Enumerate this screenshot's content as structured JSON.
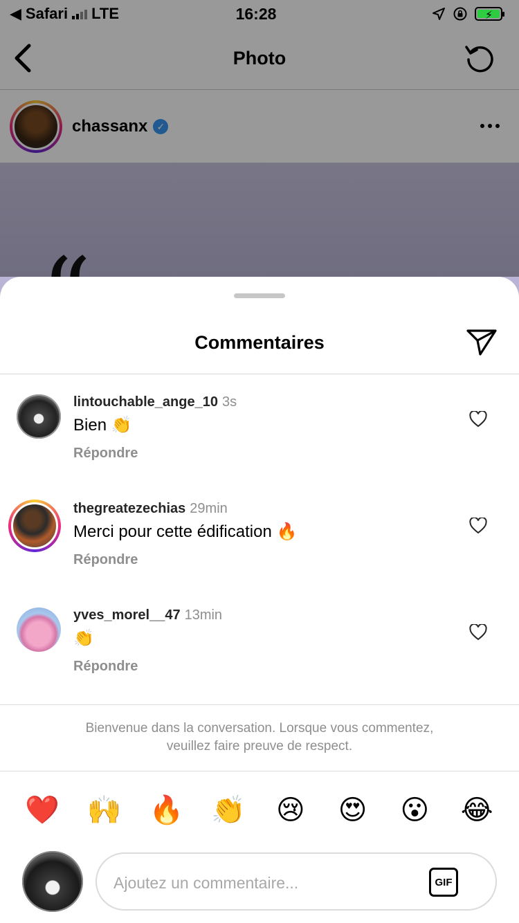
{
  "status_bar": {
    "carrier": "Safari",
    "network": "LTE",
    "time": "16:28"
  },
  "nav": {
    "title": "Photo"
  },
  "post": {
    "username": "chassanx",
    "verified_mark": "✓",
    "image_glyph": "“"
  },
  "sheet": {
    "title": "Commentaires",
    "comments": [
      {
        "user": "lintouchable_ange_10",
        "time": "3s",
        "text": "Bien 👏",
        "reply": "Répondre"
      },
      {
        "user": "thegreatezechias",
        "time": "29min",
        "text": "Merci pour cette édification 🔥",
        "reply": "Répondre"
      },
      {
        "user": "yves_morel__47",
        "time": "13min",
        "text": "👏",
        "reply": "Répondre"
      }
    ],
    "notice": "Bienvenue dans la conversation. Lorsque vous commentez, veuillez faire preuve de respect.",
    "emojis": [
      "❤️",
      "🙌",
      "🔥",
      "👏",
      "😢",
      "😍",
      "😮",
      "😂"
    ],
    "input_placeholder": "Ajoutez un commentaire...",
    "gif_label": "GIF"
  },
  "colors": {
    "secondary_text": "#8e8e8e",
    "verified_blue": "#3897f0",
    "battery_green": "#2ecc40",
    "divider": "#dbdbdb"
  },
  "icons": [
    "back-chevron-icon",
    "reload-icon",
    "more-icon",
    "verified-icon",
    "send-icon",
    "heart-icon",
    "location-arrow-icon",
    "rotation-lock-icon",
    "battery-icon",
    "signal-icon"
  ]
}
